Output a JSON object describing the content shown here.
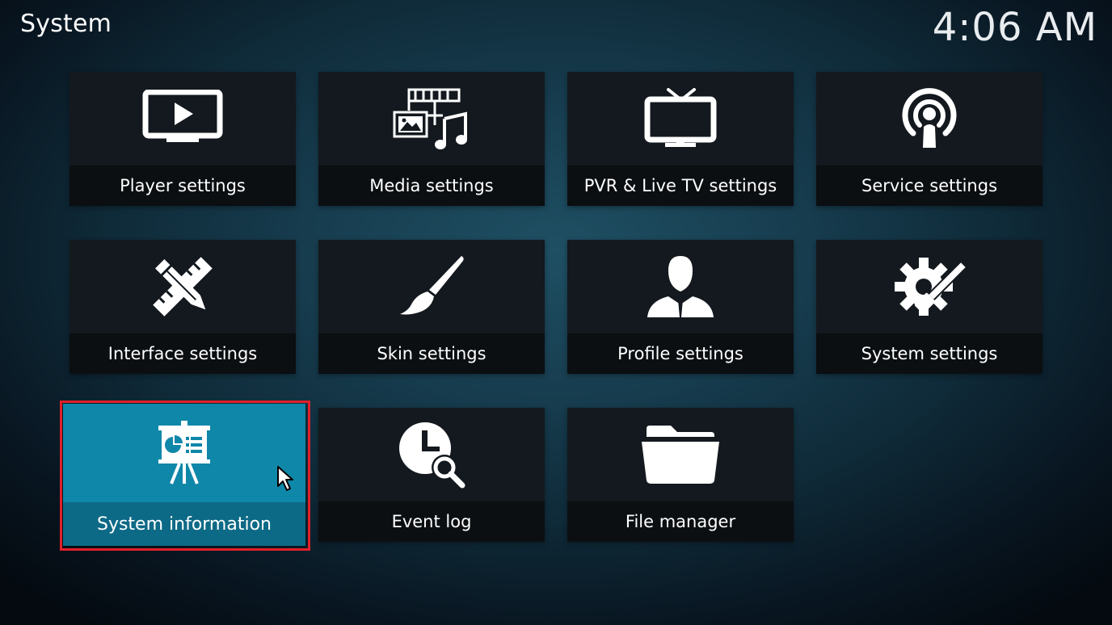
{
  "header": {
    "title": "System",
    "clock": "4:06 AM"
  },
  "tiles": [
    {
      "label": "Player settings",
      "icon": "tv-play-icon"
    },
    {
      "label": "Media settings",
      "icon": "media-icon"
    },
    {
      "label": "PVR & Live TV settings",
      "icon": "live-tv-icon"
    },
    {
      "label": "Service settings",
      "icon": "broadcast-icon"
    },
    {
      "label": "Interface settings",
      "icon": "pencil-ruler-icon"
    },
    {
      "label": "Skin settings",
      "icon": "brush-icon"
    },
    {
      "label": "Profile settings",
      "icon": "profile-icon"
    },
    {
      "label": "System settings",
      "icon": "gear-wrench-icon"
    },
    {
      "label": "System information",
      "icon": "presentation-icon",
      "focused": true
    },
    {
      "label": "Event log",
      "icon": "clock-search-icon"
    },
    {
      "label": "File manager",
      "icon": "folder-icon"
    }
  ],
  "colors": {
    "focus": "#0f87a9",
    "highlight_border": "#e0202a",
    "tile_bg": "#13191e"
  }
}
